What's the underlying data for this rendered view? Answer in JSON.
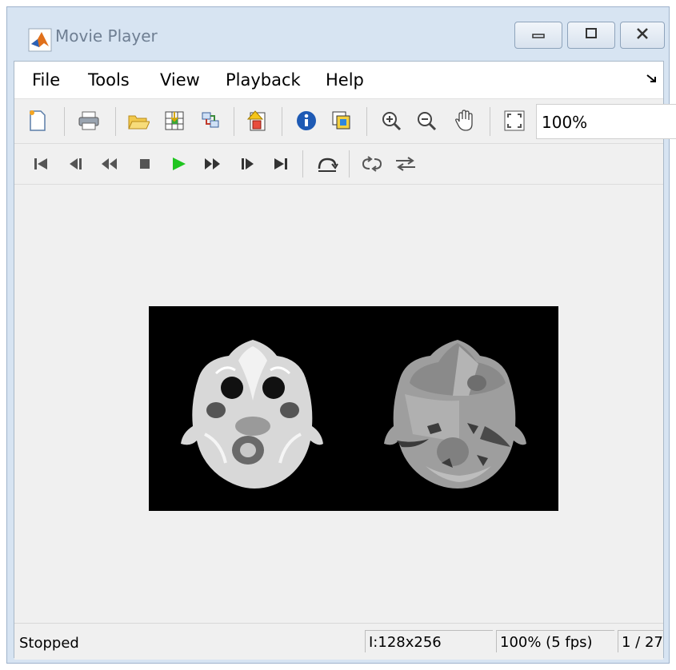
{
  "window": {
    "title": "Movie Player"
  },
  "menu": {
    "items": [
      {
        "label": "File"
      },
      {
        "label": "Tools"
      },
      {
        "label": "View"
      },
      {
        "label": "Playback"
      },
      {
        "label": "Help"
      }
    ]
  },
  "toolbar": {
    "zoom_value": "100%"
  },
  "status": {
    "state": "Stopped",
    "image_info": "I:128x256",
    "zoom_fps": "100% (5 fps)",
    "frame": "1 / 27"
  },
  "colors": {
    "play_green": "#1fc51f",
    "frame_bg": "#000000",
    "client_bg": "#f0f0f0"
  }
}
